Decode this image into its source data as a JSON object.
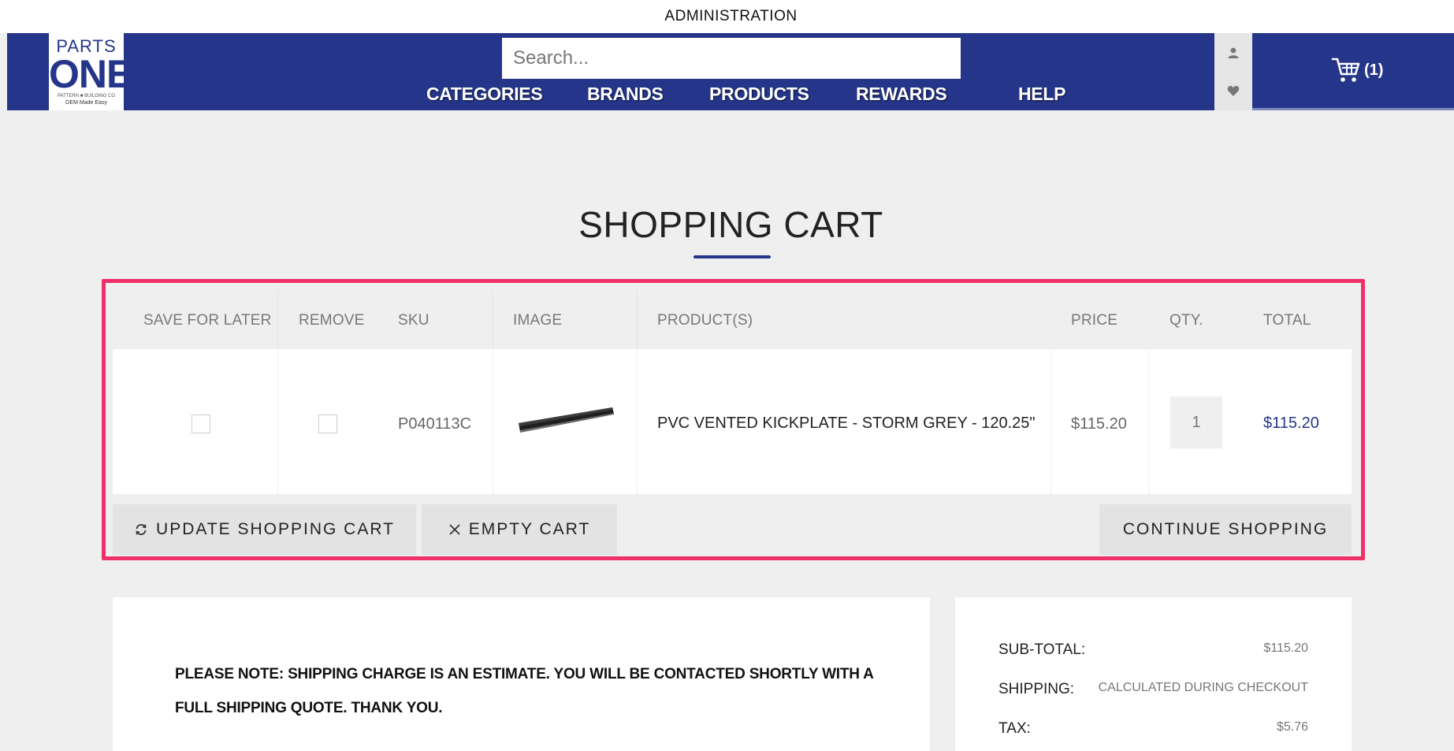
{
  "admin": {
    "label": "ADMINISTRATION"
  },
  "logo": {
    "line1": "PARTS",
    "line2": "ONE",
    "line3": "PATTERN ■ BUILDING CO",
    "line4": "OEM Made Easy"
  },
  "search": {
    "placeholder": "Search..."
  },
  "nav": {
    "items": [
      {
        "label": "CATEGORIES"
      },
      {
        "label": "BRANDS"
      },
      {
        "label": "PRODUCTS"
      },
      {
        "label": "REWARDS"
      },
      {
        "label": "HELP"
      }
    ]
  },
  "cart": {
    "count": "(1)"
  },
  "page": {
    "title": "SHOPPING CART"
  },
  "table": {
    "headers": {
      "save_for_later": "SAVE FOR LATER",
      "remove": "REMOVE",
      "sku": "SKU",
      "image": "IMAGE",
      "products": "PRODUCT(S)",
      "price": "PRICE",
      "qty": "QTY.",
      "total": "TOTAL"
    },
    "rows": [
      {
        "sku": "P040113C",
        "product": "PVC VENTED KICKPLATE - STORM GREY - 120.25\"",
        "price": "$115.20",
        "qty": "1",
        "total": "$115.20"
      }
    ]
  },
  "buttons": {
    "update": "UPDATE SHOPPING CART",
    "empty": "EMPTY CART",
    "continue": "CONTINUE SHOPPING"
  },
  "note": {
    "text": "PLEASE NOTE: SHIPPING CHARGE IS AN ESTIMATE. YOU WILL BE CONTACTED SHORTLY WITH A FULL SHIPPING QUOTE. THANK YOU."
  },
  "summary": {
    "subtotal_label": "SUB-TOTAL:",
    "subtotal_value": "$115.20",
    "shipping_label": "SHIPPING:",
    "shipping_value": "CALCULATED DURING CHECKOUT",
    "tax_label": "TAX:",
    "tax_value": "$5.76"
  },
  "colors": {
    "brand": "#25368a",
    "highlight": "#f0306b",
    "background": "#efefef"
  },
  "icons": {
    "user": "user-icon",
    "wishlist": "heart-icon",
    "cart": "cart-icon",
    "update": "refresh-icon",
    "empty": "close-icon"
  }
}
